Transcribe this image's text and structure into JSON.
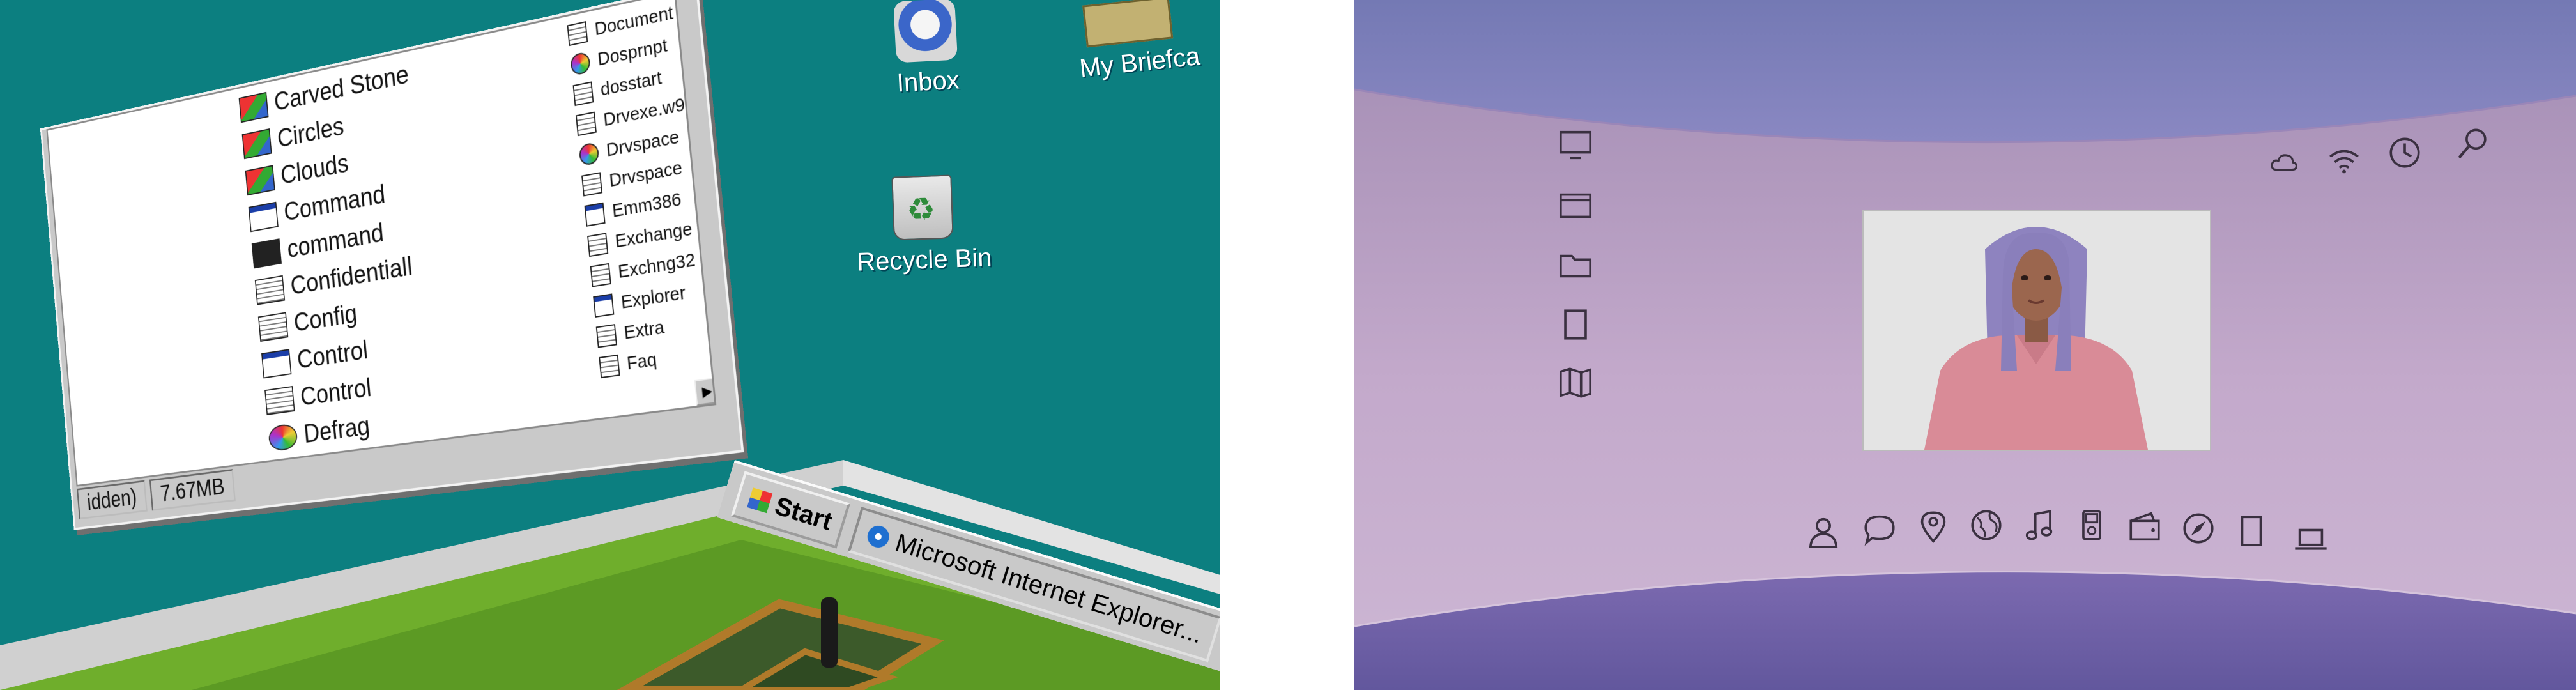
{
  "left_panel": {
    "explorer": {
      "files_large": [
        {
          "name": "Carved Stone",
          "icon": "app"
        },
        {
          "name": "Circles",
          "icon": "app"
        },
        {
          "name": "Clouds",
          "icon": "app"
        },
        {
          "name": "Command",
          "icon": "win"
        },
        {
          "name": "command",
          "icon": "dos"
        },
        {
          "name": "Confidentiall",
          "icon": "doc"
        },
        {
          "name": "Config",
          "icon": "doc"
        },
        {
          "name": "Control",
          "icon": "win"
        },
        {
          "name": "Control",
          "icon": "doc"
        },
        {
          "name": "Defrag",
          "icon": "color"
        }
      ],
      "files_small": [
        {
          "name": "Document",
          "icon": "doc"
        },
        {
          "name": "Dosprnpt",
          "icon": "color"
        },
        {
          "name": "dosstart",
          "icon": "doc"
        },
        {
          "name": "Drvexe.w9",
          "icon": "doc"
        },
        {
          "name": "Drvspace",
          "icon": "color"
        },
        {
          "name": "Drvspace",
          "icon": "doc"
        },
        {
          "name": "Emm386",
          "icon": "win"
        },
        {
          "name": "Exchange",
          "icon": "doc"
        },
        {
          "name": "Exchng32",
          "icon": "doc"
        },
        {
          "name": "Explorer",
          "icon": "win"
        },
        {
          "name": "Extra",
          "icon": "doc"
        },
        {
          "name": "Faq",
          "icon": "doc"
        }
      ],
      "status": {
        "hidden_text": "idden)",
        "size_text": "7.67MB"
      }
    },
    "desktop_icons": {
      "inbox": "Inbox",
      "briefcase": "My Briefca",
      "recycle_bin": "Recycle Bin"
    },
    "taskbar": {
      "start_label": "Start",
      "task_label": "Microsoft Internet Explorer..."
    },
    "colors": {
      "desktop_teal": "#0c7f80",
      "window_gray": "#c9c9c9",
      "floor_green": "#6fae2c"
    }
  },
  "right_panel": {
    "left_wall_icons": [
      "monitor-icon",
      "window-icon",
      "folder-icon",
      "document-icon",
      "map-icon"
    ],
    "top_right_icons": [
      "cloud-icon",
      "wifi-icon",
      "clock-icon",
      "search-icon"
    ],
    "dock_icons": [
      "person-icon",
      "chat-icon",
      "location-pin-icon",
      "globe-icon",
      "music-note-icon",
      "ipod-icon",
      "wallet-icon",
      "compass-icon",
      "document-icon",
      "laptop-icon"
    ],
    "colors": {
      "ceiling": "#7a7fb9",
      "floor": "#6a5b9f",
      "wall": "#b39ac2",
      "avatar_hair": "#8e83bf",
      "avatar_sweater": "#d98b97"
    }
  }
}
